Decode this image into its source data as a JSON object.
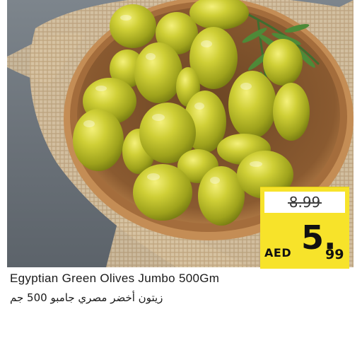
{
  "product": {
    "name_en": "Egyptian Green Olives Jumbo 500Gm",
    "name_ar": "زيتون أخضر مصري جامبو 500 جم",
    "image": "green-olives-bowl"
  },
  "price_tag": {
    "old_price": "8.99",
    "currency": "AED",
    "price_whole": "5.",
    "price_cents": "99"
  },
  "colors": {
    "price_tag": "#f7e32a",
    "olive": "#b7b92a",
    "bowl": "#c08d55",
    "background": "#6d747b"
  }
}
